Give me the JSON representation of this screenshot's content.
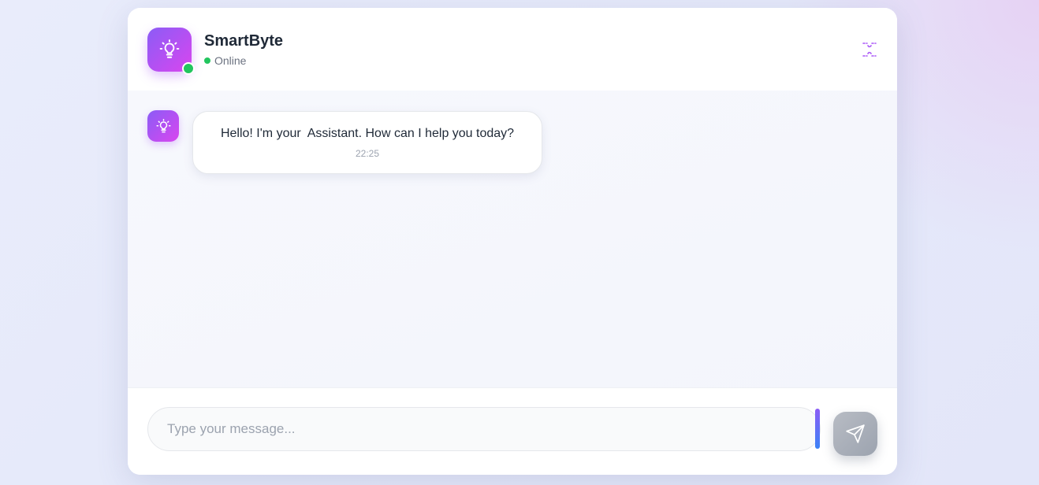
{
  "header": {
    "title": "SmartByte",
    "status": "Online",
    "avatar_icon": "lightbulb-icon",
    "expand_icon": "expand-icon"
  },
  "messages": [
    {
      "sender": "bot",
      "text": "Hello! I'm your  Assistant. How can I help you today?",
      "time": "22:25"
    }
  ],
  "composer": {
    "placeholder": "Type your message...",
    "value": "",
    "send_icon": "send-icon"
  },
  "colors": {
    "accent_start": "#8b5cf6",
    "accent_end": "#d946ef",
    "online": "#22c55e",
    "send_disabled": "#9ca3af"
  }
}
